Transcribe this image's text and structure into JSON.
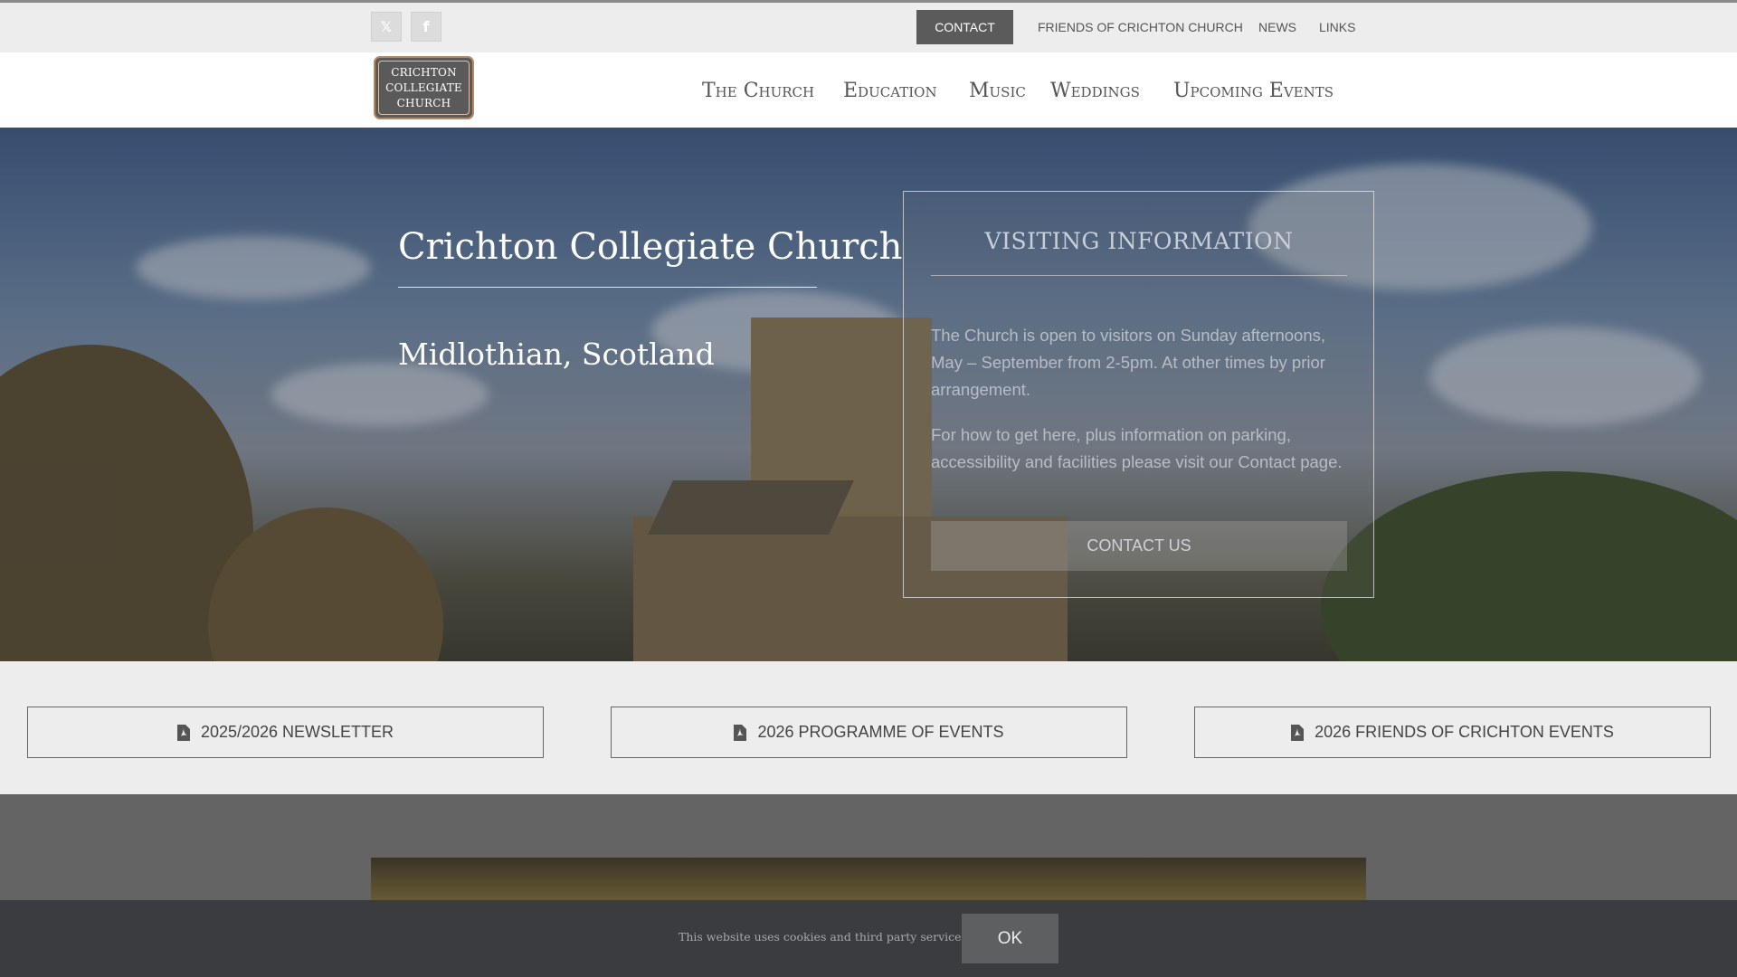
{
  "topbar": {
    "social": [
      {
        "name": "x-icon",
        "glyph": "𝕏"
      },
      {
        "name": "facebook-icon",
        "glyph": "f"
      }
    ],
    "contact_label": "CONTACT",
    "links": [
      "FRIENDS OF CRICHTON CHURCH",
      "NEWS",
      "LINKS"
    ]
  },
  "header": {
    "logo_lines": [
      "CRICHTON",
      "COLLEGIATE",
      "CHURCH"
    ],
    "nav": [
      "The Church",
      "Education",
      "Music",
      "Weddings",
      "Upcoming Events"
    ]
  },
  "hero": {
    "title": "Crichton Collegiate Church",
    "subtitle": "Midlothian, Scotland",
    "visiting": {
      "title": "VISITING INFORMATION",
      "paragraph1": "The Church is open to visitors on Sunday afternoons, May – September from 2-5pm.  At other times by prior arrangement.",
      "paragraph2": "For how to get here, plus information on parking, accessibility and facilities please visit our Contact page.",
      "button_label": "CONTACT US"
    }
  },
  "downloads": [
    {
      "label": "2025/2026 NEWSLETTER",
      "icon": "pdf-icon"
    },
    {
      "label": "2026 PROGRAMME OF EVENTS",
      "icon": "pdf-icon"
    },
    {
      "label": "2026 FRIENDS OF CRICHTON EVENTS",
      "icon": "pdf-icon"
    }
  ],
  "cookie": {
    "text": "This website uses cookies and third party services.",
    "ok_label": "OK"
  },
  "colors": {
    "top_bar": "#ededed",
    "contact_button": "#5b5b5b",
    "cookie_bar": "#3b3c3f",
    "lower_section": "#646464"
  }
}
